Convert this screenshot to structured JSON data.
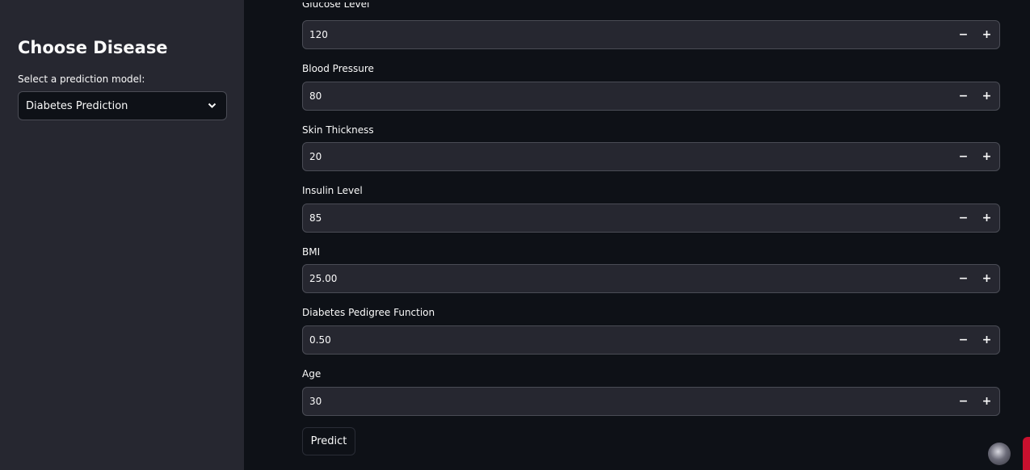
{
  "sidebar": {
    "title": "Choose Disease",
    "select_label": "Select a prediction model:",
    "select_value": "Diabetes Prediction"
  },
  "form": {
    "fields": [
      {
        "label": "Glucose Level",
        "value": "120"
      },
      {
        "label": "Blood Pressure",
        "value": "80"
      },
      {
        "label": "Skin Thickness",
        "value": "20"
      },
      {
        "label": "Insulin Level",
        "value": "85"
      },
      {
        "label": "BMI",
        "value": "25.00"
      },
      {
        "label": "Diabetes Pedigree Function",
        "value": "0.50"
      },
      {
        "label": "Age",
        "value": "30"
      }
    ],
    "minus_symbol": "−",
    "plus_symbol": "+",
    "submit_label": "Predict"
  },
  "colors": {
    "background": "#0e1117",
    "sidebar": "#262730",
    "input": "#262730",
    "accent": "#c8102e"
  }
}
